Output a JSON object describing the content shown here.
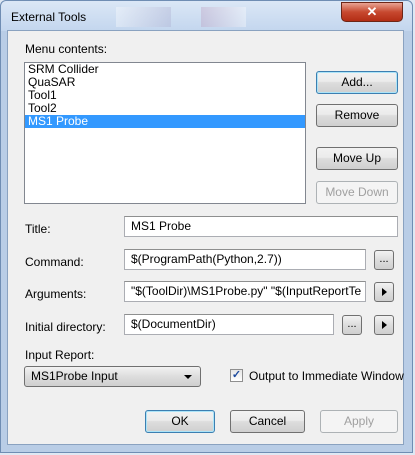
{
  "window": {
    "title": "External Tools",
    "close_glyph": "✕"
  },
  "menu_contents": {
    "label": "Menu contents:",
    "items": [
      "SRM Collider",
      "QuaSAR",
      "Tool1",
      "Tool2",
      "MS1 Probe"
    ],
    "selected_index": 4
  },
  "side_buttons": {
    "add": "Add...",
    "remove": "Remove",
    "move_up": "Move Up",
    "move_down": "Move Down"
  },
  "fields": {
    "title": {
      "label": "Title:",
      "value": "MS1 Probe"
    },
    "command": {
      "label": "Command:",
      "value": "$(ProgramPath(Python,2.7))"
    },
    "arguments": {
      "label": "Arguments:",
      "value": "\"$(ToolDir)\\MS1Probe.py\" \"$(InputReportTe"
    },
    "initial_directory": {
      "label": "Initial directory:",
      "value": "$(DocumentDir)"
    }
  },
  "browse_label": "...",
  "input_report": {
    "label": "Input Report:",
    "selected": "MS1Probe Input"
  },
  "output_checkbox": {
    "label": "Output to Immediate Window",
    "checked": true,
    "check_glyph": "✓"
  },
  "footer": {
    "ok": "OK",
    "cancel": "Cancel",
    "apply": "Apply"
  },
  "icons": [
    "close-icon",
    "play-arrow-icon",
    "dropdown-arrow-icon",
    "checkmark-icon"
  ]
}
